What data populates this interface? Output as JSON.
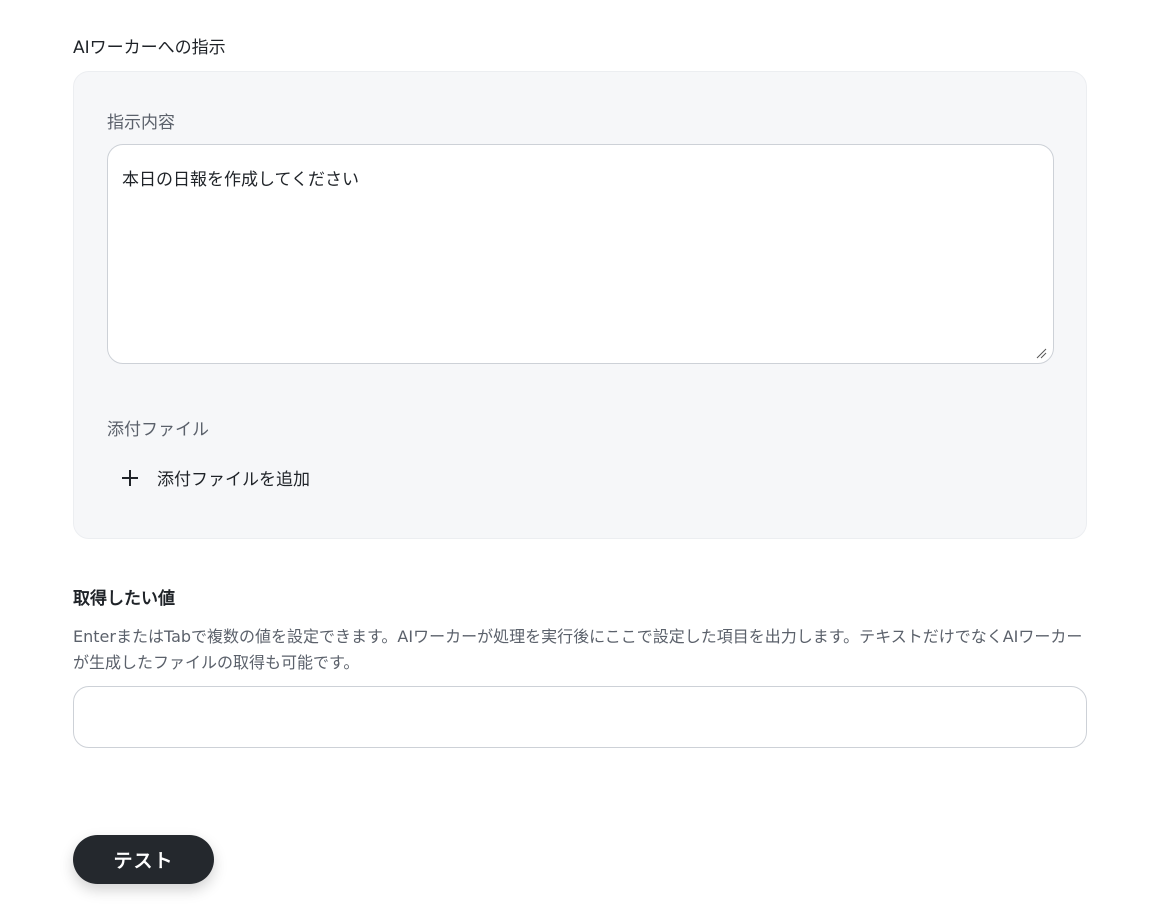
{
  "instruction_section": {
    "title": "AIワーカーへの指示",
    "content_label": "指示内容",
    "content_value": "本日の日報を作成してください",
    "attachment_label": "添付ファイル",
    "add_attachment_label": "添付ファイルを追加"
  },
  "output_section": {
    "title": "取得したい値",
    "description": "EnterまたはTabで複数の値を設定できます。AIワーカーが処理を実行後にここで設定した項目を出力します。テキストだけでなくAIワーカーが生成したファイルの取得も可能です。",
    "input_value": ""
  },
  "actions": {
    "test_label": "テスト"
  },
  "colors": {
    "panel_bg": "#f6f7f9",
    "button_bg": "#24282d",
    "label_gray": "#5b616b"
  }
}
